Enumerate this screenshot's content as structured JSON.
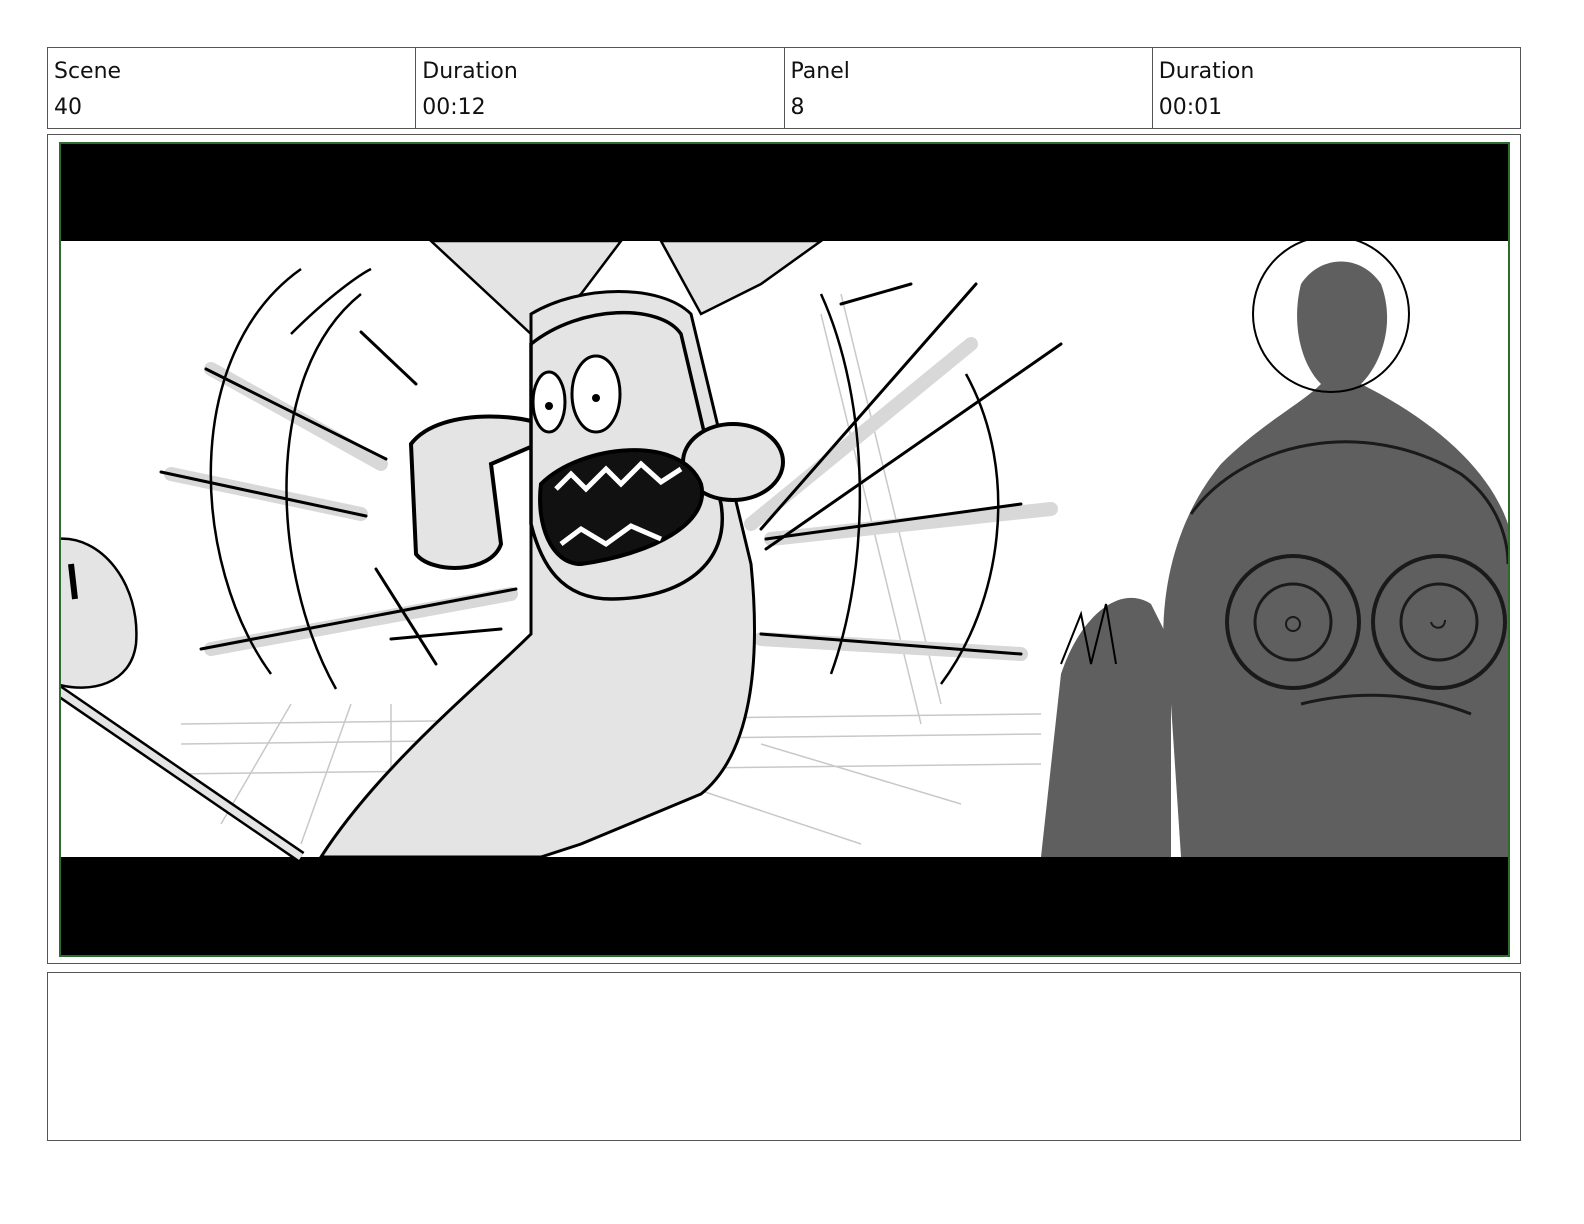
{
  "header": {
    "scene_label": "Scene",
    "scene_value": "40",
    "scene_duration_label": "Duration",
    "scene_duration_value": "00:12",
    "panel_label": "Panel",
    "panel_value": "8",
    "panel_duration_label": "Duration",
    "panel_duration_value": "00:01"
  },
  "notes": {
    "text": ""
  },
  "colors": {
    "frame_border": "#2e6b2e",
    "letterbox": "#000000",
    "sketch_fill": "#e4e4e4",
    "shadow_figure": "#5f5f5f"
  }
}
